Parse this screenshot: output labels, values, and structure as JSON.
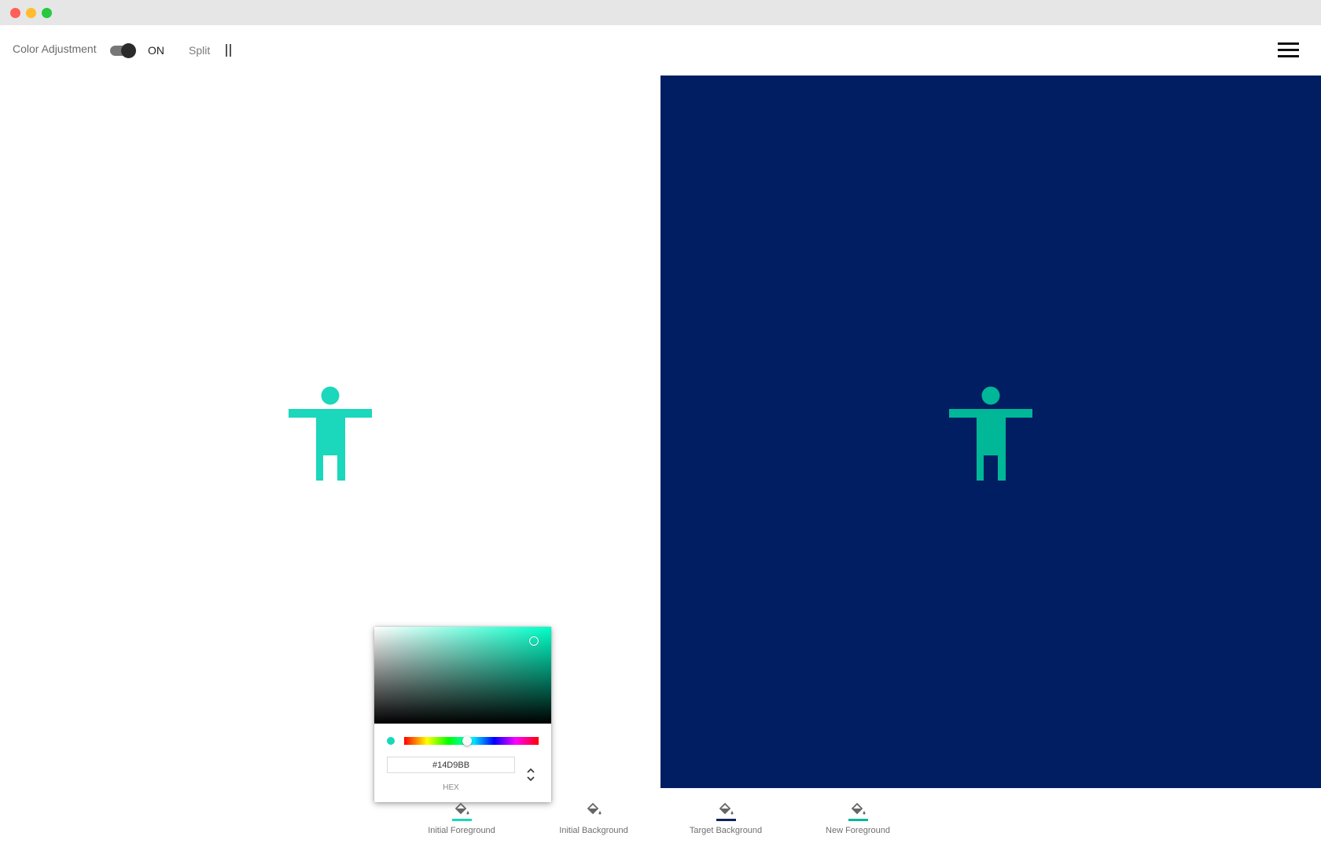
{
  "toolbar": {
    "color_adjustment_label": "Color Adjustment",
    "switch_state": "ON",
    "split_label": "Split",
    "menu_icon": "hamburger-menu-icon"
  },
  "preview": {
    "initial_foreground": "#1BD7BB",
    "initial_background": "#FFFFFF",
    "target_background": "#011E62",
    "new_foreground": "#00B798",
    "figure_icon": "accessibility-person-icon"
  },
  "color_picker": {
    "hex_value": "#14D9BB",
    "hex_label": "HEX",
    "hue_color": "#00FFC8",
    "hue_fraction": 0.47,
    "swatch_color": "#14D9BB",
    "mode_toggle_icon": "chevron-up-down-icon"
  },
  "tabs": [
    {
      "label": "Initial Foreground",
      "color": "#1BD7BB",
      "icon": "paint-bucket-icon"
    },
    {
      "label": "Initial Background",
      "color": "#FFFFFF",
      "icon": "paint-bucket-icon"
    },
    {
      "label": "Target Background",
      "color": "#0F2260",
      "icon": "paint-bucket-icon"
    },
    {
      "label": "New Foreground",
      "color": "#00B798",
      "icon": "paint-bucket-icon"
    }
  ]
}
